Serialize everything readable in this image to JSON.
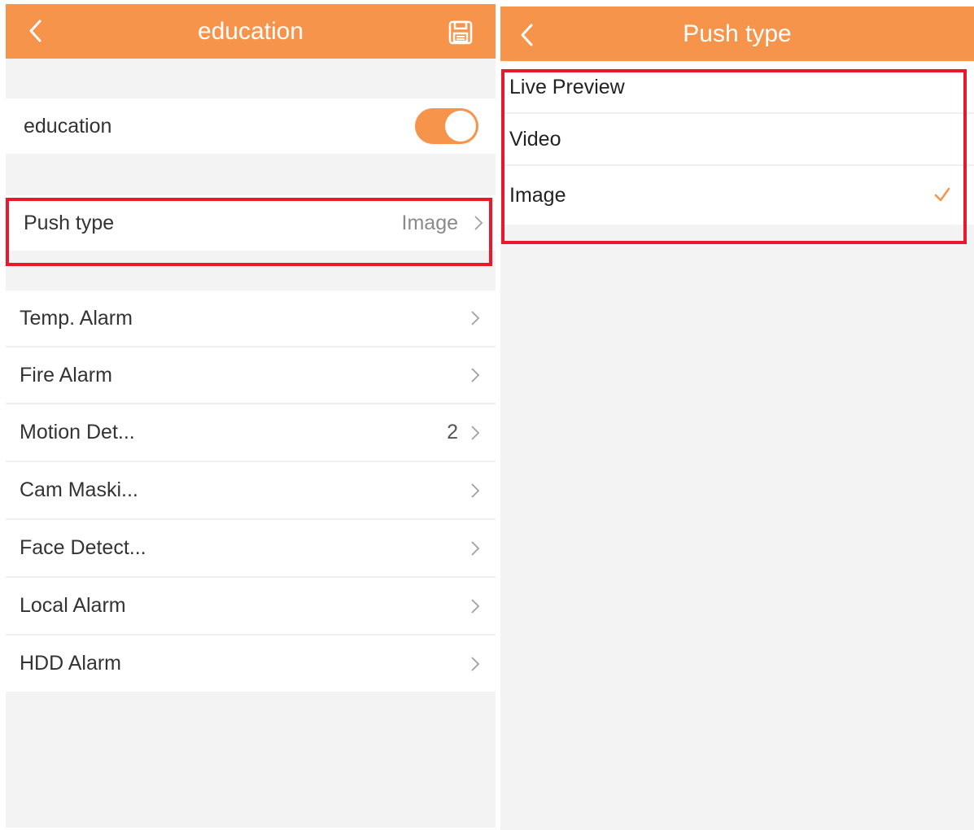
{
  "left_screen": {
    "header": {
      "title": "education",
      "back_icon": "back-chevron-icon",
      "save_icon": "save-disk-icon"
    },
    "toggle_row": {
      "label": "education",
      "enabled": true
    },
    "push_type_row": {
      "label": "Push type",
      "value": "Image"
    },
    "alarm_items": [
      {
        "label": "Temp. Alarm",
        "count": ""
      },
      {
        "label": "Fire Alarm",
        "count": ""
      },
      {
        "label": "Motion Det...",
        "count": "2"
      },
      {
        "label": "Cam Maski...",
        "count": ""
      },
      {
        "label": "Face Detect...",
        "count": ""
      },
      {
        "label": "Local Alarm",
        "count": ""
      },
      {
        "label": "HDD Alarm",
        "count": ""
      }
    ]
  },
  "right_screen": {
    "header": {
      "title": "Push type",
      "back_icon": "back-chevron-icon"
    },
    "options": [
      {
        "label": "Live Preview",
        "selected": false
      },
      {
        "label": "Video",
        "selected": false
      },
      {
        "label": "Image",
        "selected": true
      }
    ]
  },
  "colors": {
    "accent": "#f7944b",
    "highlight": "#e8192c",
    "background": "#f3f3f3"
  }
}
